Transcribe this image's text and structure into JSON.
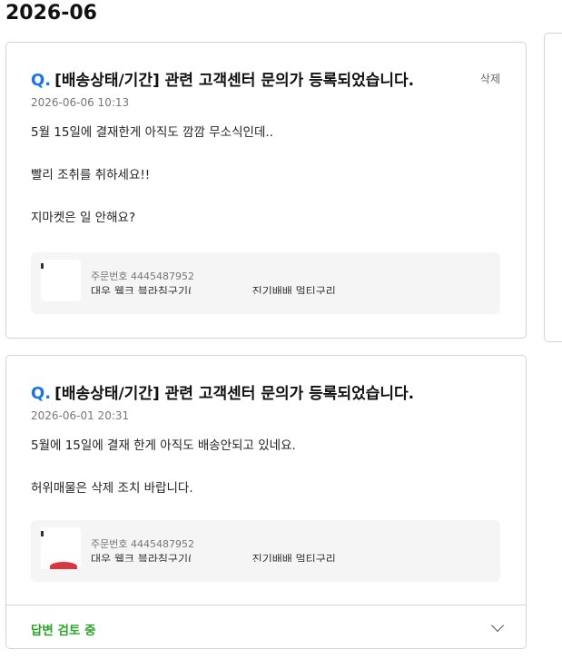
{
  "month_header": "2026-06",
  "inquiries": [
    {
      "q_mark": "Q.",
      "title": "[배송상태/기간] 관련 고객센터 문의가 등록되었습니다.",
      "delete_label": "삭제",
      "datetime": "2026-06-06 10:13",
      "lines": [
        "5월 15일에 결재한게 아직도 깜깜 무소식인데..",
        "빨리 조취를 취하세요!!",
        "지마켓은 일 안해요?"
      ],
      "order": {
        "label": "주문번호 4445487952",
        "product": "대우 웰크 블라침구기(TC-8300S) 진기배배 멀티구리"
      }
    },
    {
      "q_mark": "Q.",
      "title": "[배송상태/기간] 관련 고객센터 문의가 등록되었습니다.",
      "datetime": "2026-06-01 20:31",
      "lines": [
        "5월에 15일에 결재 한게 아직도 배송안되고 있네요.",
        "허위매물은 삭제 조치 바랍니다."
      ],
      "order": {
        "label": "주문번호 4445487952",
        "product": "대우 웰크 블라침구기(TC-8300S) 진기배배 멀티구리"
      },
      "status": "답변 검토 중"
    }
  ],
  "colors": {
    "accent_blue": "#1a73e8",
    "status_green": "#2aa52a"
  },
  "icons": {
    "expand": "chevron-down-icon"
  }
}
